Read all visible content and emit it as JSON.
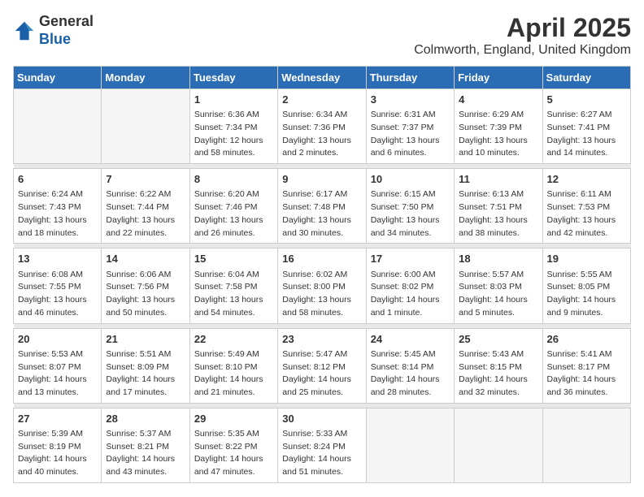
{
  "header": {
    "logo_general": "General",
    "logo_blue": "Blue",
    "month_year": "April 2025",
    "location": "Colmworth, England, United Kingdom"
  },
  "weekdays": [
    "Sunday",
    "Monday",
    "Tuesday",
    "Wednesday",
    "Thursday",
    "Friday",
    "Saturday"
  ],
  "weeks": [
    [
      {
        "day": "",
        "info": ""
      },
      {
        "day": "",
        "info": ""
      },
      {
        "day": "1",
        "info": "Sunrise: 6:36 AM\nSunset: 7:34 PM\nDaylight: 12 hours\nand 58 minutes."
      },
      {
        "day": "2",
        "info": "Sunrise: 6:34 AM\nSunset: 7:36 PM\nDaylight: 13 hours\nand 2 minutes."
      },
      {
        "day": "3",
        "info": "Sunrise: 6:31 AM\nSunset: 7:37 PM\nDaylight: 13 hours\nand 6 minutes."
      },
      {
        "day": "4",
        "info": "Sunrise: 6:29 AM\nSunset: 7:39 PM\nDaylight: 13 hours\nand 10 minutes."
      },
      {
        "day": "5",
        "info": "Sunrise: 6:27 AM\nSunset: 7:41 PM\nDaylight: 13 hours\nand 14 minutes."
      }
    ],
    [
      {
        "day": "6",
        "info": "Sunrise: 6:24 AM\nSunset: 7:43 PM\nDaylight: 13 hours\nand 18 minutes."
      },
      {
        "day": "7",
        "info": "Sunrise: 6:22 AM\nSunset: 7:44 PM\nDaylight: 13 hours\nand 22 minutes."
      },
      {
        "day": "8",
        "info": "Sunrise: 6:20 AM\nSunset: 7:46 PM\nDaylight: 13 hours\nand 26 minutes."
      },
      {
        "day": "9",
        "info": "Sunrise: 6:17 AM\nSunset: 7:48 PM\nDaylight: 13 hours\nand 30 minutes."
      },
      {
        "day": "10",
        "info": "Sunrise: 6:15 AM\nSunset: 7:50 PM\nDaylight: 13 hours\nand 34 minutes."
      },
      {
        "day": "11",
        "info": "Sunrise: 6:13 AM\nSunset: 7:51 PM\nDaylight: 13 hours\nand 38 minutes."
      },
      {
        "day": "12",
        "info": "Sunrise: 6:11 AM\nSunset: 7:53 PM\nDaylight: 13 hours\nand 42 minutes."
      }
    ],
    [
      {
        "day": "13",
        "info": "Sunrise: 6:08 AM\nSunset: 7:55 PM\nDaylight: 13 hours\nand 46 minutes."
      },
      {
        "day": "14",
        "info": "Sunrise: 6:06 AM\nSunset: 7:56 PM\nDaylight: 13 hours\nand 50 minutes."
      },
      {
        "day": "15",
        "info": "Sunrise: 6:04 AM\nSunset: 7:58 PM\nDaylight: 13 hours\nand 54 minutes."
      },
      {
        "day": "16",
        "info": "Sunrise: 6:02 AM\nSunset: 8:00 PM\nDaylight: 13 hours\nand 58 minutes."
      },
      {
        "day": "17",
        "info": "Sunrise: 6:00 AM\nSunset: 8:02 PM\nDaylight: 14 hours\nand 1 minute."
      },
      {
        "day": "18",
        "info": "Sunrise: 5:57 AM\nSunset: 8:03 PM\nDaylight: 14 hours\nand 5 minutes."
      },
      {
        "day": "19",
        "info": "Sunrise: 5:55 AM\nSunset: 8:05 PM\nDaylight: 14 hours\nand 9 minutes."
      }
    ],
    [
      {
        "day": "20",
        "info": "Sunrise: 5:53 AM\nSunset: 8:07 PM\nDaylight: 14 hours\nand 13 minutes."
      },
      {
        "day": "21",
        "info": "Sunrise: 5:51 AM\nSunset: 8:09 PM\nDaylight: 14 hours\nand 17 minutes."
      },
      {
        "day": "22",
        "info": "Sunrise: 5:49 AM\nSunset: 8:10 PM\nDaylight: 14 hours\nand 21 minutes."
      },
      {
        "day": "23",
        "info": "Sunrise: 5:47 AM\nSunset: 8:12 PM\nDaylight: 14 hours\nand 25 minutes."
      },
      {
        "day": "24",
        "info": "Sunrise: 5:45 AM\nSunset: 8:14 PM\nDaylight: 14 hours\nand 28 minutes."
      },
      {
        "day": "25",
        "info": "Sunrise: 5:43 AM\nSunset: 8:15 PM\nDaylight: 14 hours\nand 32 minutes."
      },
      {
        "day": "26",
        "info": "Sunrise: 5:41 AM\nSunset: 8:17 PM\nDaylight: 14 hours\nand 36 minutes."
      }
    ],
    [
      {
        "day": "27",
        "info": "Sunrise: 5:39 AM\nSunset: 8:19 PM\nDaylight: 14 hours\nand 40 minutes."
      },
      {
        "day": "28",
        "info": "Sunrise: 5:37 AM\nSunset: 8:21 PM\nDaylight: 14 hours\nand 43 minutes."
      },
      {
        "day": "29",
        "info": "Sunrise: 5:35 AM\nSunset: 8:22 PM\nDaylight: 14 hours\nand 47 minutes."
      },
      {
        "day": "30",
        "info": "Sunrise: 5:33 AM\nSunset: 8:24 PM\nDaylight: 14 hours\nand 51 minutes."
      },
      {
        "day": "",
        "info": ""
      },
      {
        "day": "",
        "info": ""
      },
      {
        "day": "",
        "info": ""
      }
    ]
  ]
}
